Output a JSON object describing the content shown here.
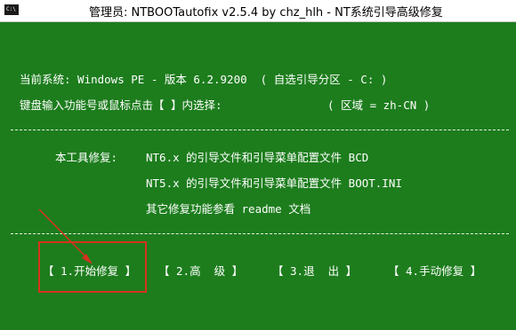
{
  "window": {
    "icon_label": "C:\\",
    "title": "管理员:  NTBOOTautofix v2.5.4 by chz_hlh - NT系统引导高级修复"
  },
  "info": {
    "current_system": "当前系统: Windows PE - 版本 6.2.9200  ( 自选引导分区 - C: )",
    "keyboard_prompt": "键盘输入功能号或鼠标点击【 】内选择:",
    "region": "( 区域 = zh-CN )"
  },
  "repair": {
    "label": "本工具修复:",
    "nt6": "NT6.x 的引导文件和引导菜单配置文件 BCD",
    "nt5": "NT5.x 的引导文件和引导菜单配置文件 BOOT.INI",
    "other": "其它修复功能参看 readme 文档"
  },
  "menu": {
    "start_repair": "【 1.开始修复 】",
    "advanced": "【 2.高  级 】",
    "exit": "【 3.退  出 】",
    "manual_repair": "【 4.手动修复 】"
  },
  "colors": {
    "background": "#1d7d1d",
    "text": "#ffffff",
    "annotation": "#d8321c"
  }
}
